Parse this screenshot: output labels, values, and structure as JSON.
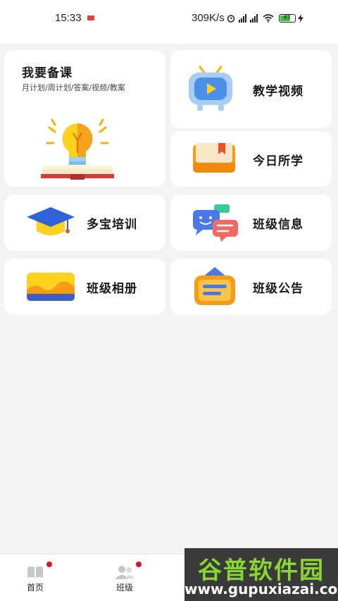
{
  "status": {
    "time": "15:33",
    "speed": "309K/s",
    "battery": "67"
  },
  "cards": {
    "prepare": {
      "title": "我要备课",
      "subtitle": "月计划/周计划/答案/视频/教案"
    },
    "video": {
      "title": "教学视频"
    },
    "today": {
      "title": "今日所学"
    },
    "training": {
      "title": "多宝培训"
    },
    "class_info": {
      "title": "班级信息"
    },
    "album": {
      "title": "班级相册"
    },
    "notice": {
      "title": "班级公告"
    }
  },
  "tabs": [
    {
      "label": "首页",
      "icon": "book-icon"
    },
    {
      "label": "班级",
      "icon": "people-icon"
    }
  ],
  "watermark": {
    "title": "谷普软件园",
    "url": "www.gupuxiazai.com"
  },
  "colors": {
    "background": "#f3f3f3",
    "card": "#ffffff",
    "badge_red": "#e0112b",
    "accent_blue": "#4a78e8",
    "accent_orange": "#f5a623"
  }
}
